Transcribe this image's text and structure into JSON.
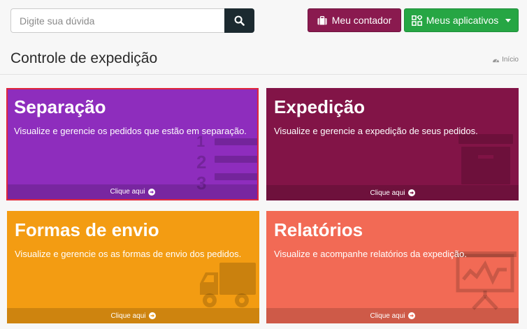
{
  "search": {
    "placeholder": "Digite sua dúvida"
  },
  "header": {
    "contador_label": "Meu contador",
    "apps_label": "Meus aplicativos"
  },
  "page": {
    "title": "Controle de expedição",
    "breadcrumb": "Início"
  },
  "tiles": [
    {
      "title": "Separação",
      "description": "Visualize e gerencie os pedidos que estão em separação.",
      "link": "Clique aqui",
      "color": "#8e2dbd"
    },
    {
      "title": "Expedição",
      "description": "Visualize e gerencie a expedição de seus pedidos.",
      "link": "Clique aqui",
      "color": "#821447"
    },
    {
      "title": "Formas de envio",
      "description": "Visualize e gerencie os as formas de envio dos pedidos.",
      "link": "Clique aqui",
      "color": "#f39c12"
    },
    {
      "title": "Relatórios",
      "description": "Visualize e acompanhe relatórios da expedição.",
      "link": "Clique aqui",
      "color": "#f26a55"
    }
  ],
  "icons": {
    "search": "search-icon",
    "contador": "briefcase-icon",
    "apps": "apps-grid-icon",
    "breadcrumb": "dashboard-icon",
    "tile1": "ordered-list-icon",
    "tile2": "archive-box-icon",
    "tile3": "truck-icon",
    "tile4": "presentation-chart-icon",
    "link": "arrow-circle-right-icon"
  }
}
